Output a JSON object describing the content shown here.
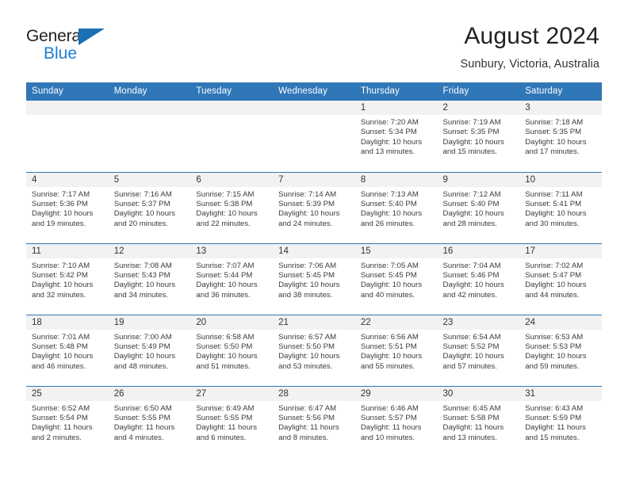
{
  "logo": {
    "word_top": "General",
    "word_bottom": "Blue",
    "triangle_color": "#1b6fb3",
    "blue_color": "#1a7fd4",
    "icon": "triangle-icon"
  },
  "header": {
    "month_title": "August 2024",
    "location": "Sunbury, Victoria, Australia"
  },
  "theme": {
    "header_blue": "#3077b8",
    "daynum_band": "#f2f2f2",
    "text": "#3b3b3b"
  },
  "calendar": {
    "weekday_headers": [
      "Sunday",
      "Monday",
      "Tuesday",
      "Wednesday",
      "Thursday",
      "Friday",
      "Saturday"
    ],
    "weeks": [
      [
        {
          "empty": true,
          "day": ""
        },
        {
          "empty": true,
          "day": ""
        },
        {
          "empty": true,
          "day": ""
        },
        {
          "empty": true,
          "day": ""
        },
        {
          "day": "1",
          "sunrise": "Sunrise: 7:20 AM",
          "sunset": "Sunset: 5:34 PM",
          "daylight": "Daylight: 10 hours and 13 minutes."
        },
        {
          "day": "2",
          "sunrise": "Sunrise: 7:19 AM",
          "sunset": "Sunset: 5:35 PM",
          "daylight": "Daylight: 10 hours and 15 minutes."
        },
        {
          "day": "3",
          "sunrise": "Sunrise: 7:18 AM",
          "sunset": "Sunset: 5:35 PM",
          "daylight": "Daylight: 10 hours and 17 minutes."
        }
      ],
      [
        {
          "day": "4",
          "sunrise": "Sunrise: 7:17 AM",
          "sunset": "Sunset: 5:36 PM",
          "daylight": "Daylight: 10 hours and 19 minutes."
        },
        {
          "day": "5",
          "sunrise": "Sunrise: 7:16 AM",
          "sunset": "Sunset: 5:37 PM",
          "daylight": "Daylight: 10 hours and 20 minutes."
        },
        {
          "day": "6",
          "sunrise": "Sunrise: 7:15 AM",
          "sunset": "Sunset: 5:38 PM",
          "daylight": "Daylight: 10 hours and 22 minutes."
        },
        {
          "day": "7",
          "sunrise": "Sunrise: 7:14 AM",
          "sunset": "Sunset: 5:39 PM",
          "daylight": "Daylight: 10 hours and 24 minutes."
        },
        {
          "day": "8",
          "sunrise": "Sunrise: 7:13 AM",
          "sunset": "Sunset: 5:40 PM",
          "daylight": "Daylight: 10 hours and 26 minutes."
        },
        {
          "day": "9",
          "sunrise": "Sunrise: 7:12 AM",
          "sunset": "Sunset: 5:40 PM",
          "daylight": "Daylight: 10 hours and 28 minutes."
        },
        {
          "day": "10",
          "sunrise": "Sunrise: 7:11 AM",
          "sunset": "Sunset: 5:41 PM",
          "daylight": "Daylight: 10 hours and 30 minutes."
        }
      ],
      [
        {
          "day": "11",
          "sunrise": "Sunrise: 7:10 AM",
          "sunset": "Sunset: 5:42 PM",
          "daylight": "Daylight: 10 hours and 32 minutes."
        },
        {
          "day": "12",
          "sunrise": "Sunrise: 7:08 AM",
          "sunset": "Sunset: 5:43 PM",
          "daylight": "Daylight: 10 hours and 34 minutes."
        },
        {
          "day": "13",
          "sunrise": "Sunrise: 7:07 AM",
          "sunset": "Sunset: 5:44 PM",
          "daylight": "Daylight: 10 hours and 36 minutes."
        },
        {
          "day": "14",
          "sunrise": "Sunrise: 7:06 AM",
          "sunset": "Sunset: 5:45 PM",
          "daylight": "Daylight: 10 hours and 38 minutes."
        },
        {
          "day": "15",
          "sunrise": "Sunrise: 7:05 AM",
          "sunset": "Sunset: 5:45 PM",
          "daylight": "Daylight: 10 hours and 40 minutes."
        },
        {
          "day": "16",
          "sunrise": "Sunrise: 7:04 AM",
          "sunset": "Sunset: 5:46 PM",
          "daylight": "Daylight: 10 hours and 42 minutes."
        },
        {
          "day": "17",
          "sunrise": "Sunrise: 7:02 AM",
          "sunset": "Sunset: 5:47 PM",
          "daylight": "Daylight: 10 hours and 44 minutes."
        }
      ],
      [
        {
          "day": "18",
          "sunrise": "Sunrise: 7:01 AM",
          "sunset": "Sunset: 5:48 PM",
          "daylight": "Daylight: 10 hours and 46 minutes."
        },
        {
          "day": "19",
          "sunrise": "Sunrise: 7:00 AM",
          "sunset": "Sunset: 5:49 PM",
          "daylight": "Daylight: 10 hours and 48 minutes."
        },
        {
          "day": "20",
          "sunrise": "Sunrise: 6:58 AM",
          "sunset": "Sunset: 5:50 PM",
          "daylight": "Daylight: 10 hours and 51 minutes."
        },
        {
          "day": "21",
          "sunrise": "Sunrise: 6:57 AM",
          "sunset": "Sunset: 5:50 PM",
          "daylight": "Daylight: 10 hours and 53 minutes."
        },
        {
          "day": "22",
          "sunrise": "Sunrise: 6:56 AM",
          "sunset": "Sunset: 5:51 PM",
          "daylight": "Daylight: 10 hours and 55 minutes."
        },
        {
          "day": "23",
          "sunrise": "Sunrise: 6:54 AM",
          "sunset": "Sunset: 5:52 PM",
          "daylight": "Daylight: 10 hours and 57 minutes."
        },
        {
          "day": "24",
          "sunrise": "Sunrise: 6:53 AM",
          "sunset": "Sunset: 5:53 PM",
          "daylight": "Daylight: 10 hours and 59 minutes."
        }
      ],
      [
        {
          "day": "25",
          "sunrise": "Sunrise: 6:52 AM",
          "sunset": "Sunset: 5:54 PM",
          "daylight": "Daylight: 11 hours and 2 minutes."
        },
        {
          "day": "26",
          "sunrise": "Sunrise: 6:50 AM",
          "sunset": "Sunset: 5:55 PM",
          "daylight": "Daylight: 11 hours and 4 minutes."
        },
        {
          "day": "27",
          "sunrise": "Sunrise: 6:49 AM",
          "sunset": "Sunset: 5:55 PM",
          "daylight": "Daylight: 11 hours and 6 minutes."
        },
        {
          "day": "28",
          "sunrise": "Sunrise: 6:47 AM",
          "sunset": "Sunset: 5:56 PM",
          "daylight": "Daylight: 11 hours and 8 minutes."
        },
        {
          "day": "29",
          "sunrise": "Sunrise: 6:46 AM",
          "sunset": "Sunset: 5:57 PM",
          "daylight": "Daylight: 11 hours and 10 minutes."
        },
        {
          "day": "30",
          "sunrise": "Sunrise: 6:45 AM",
          "sunset": "Sunset: 5:58 PM",
          "daylight": "Daylight: 11 hours and 13 minutes."
        },
        {
          "day": "31",
          "sunrise": "Sunrise: 6:43 AM",
          "sunset": "Sunset: 5:59 PM",
          "daylight": "Daylight: 11 hours and 15 minutes."
        }
      ]
    ]
  }
}
